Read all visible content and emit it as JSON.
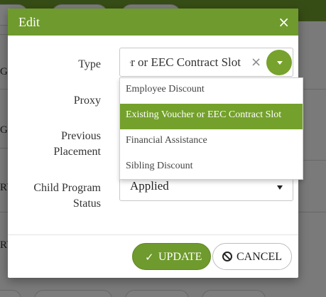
{
  "background": {
    "row_labels": [
      "G",
      "G",
      "RY",
      "RY"
    ]
  },
  "modal": {
    "title": "Edit",
    "close_glyph": "×",
    "fields": {
      "type_label": "Type",
      "proxy_label": "Proxy",
      "previous_placement_label_line1": "Previous",
      "previous_placement_label_line2": "Placement",
      "child_program_status_label_line1": "Child Program",
      "child_program_status_label_line2": "Status"
    },
    "type_select": {
      "value": "er or EEC Contract Slot",
      "clear_glyph": "×",
      "toggle_icon": "chevron-down-icon",
      "options": [
        "Employee Discount",
        "Existing Voucher or EEC Contract Slot",
        "Financial Assistance",
        "Sibling Discount"
      ],
      "selected_option": "Existing Voucher or EEC Contract Slot"
    },
    "status_select": {
      "value": "Applied"
    },
    "buttons": {
      "update_label": "UPDATE",
      "update_icon": "check-icon",
      "cancel_label": "CANCEL",
      "cancel_icon": "ban-icon"
    }
  },
  "colors": {
    "header_green": "#6f9a2d",
    "selected_option_green": "#74a12b"
  }
}
